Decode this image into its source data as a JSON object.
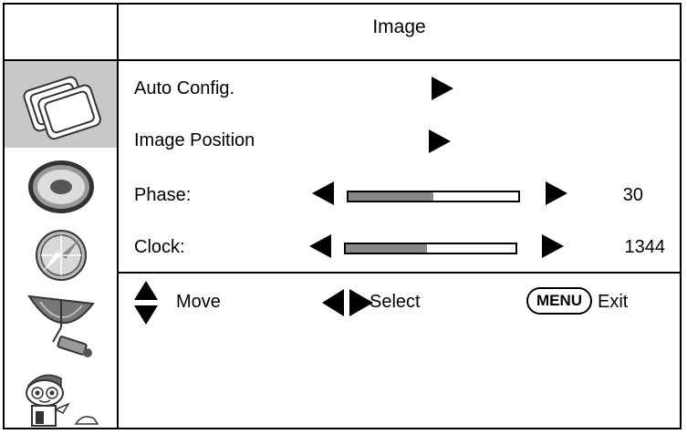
{
  "header": {
    "title": "Image"
  },
  "sidebar": {
    "items": [
      {
        "icon": "image-icon",
        "selected": true
      },
      {
        "icon": "disc-icon",
        "selected": false
      },
      {
        "icon": "compass-icon",
        "selected": false
      },
      {
        "icon": "satellite-dish-icon",
        "selected": false
      },
      {
        "icon": "mascot-icon",
        "selected": false
      }
    ]
  },
  "menu": {
    "auto_config": {
      "label": "Auto Config."
    },
    "image_position": {
      "label": "Image Position"
    },
    "phase": {
      "label": "Phase:",
      "value": "30",
      "level": 0.5
    },
    "clock": {
      "label": "Clock:",
      "value": "1344",
      "level": 0.48
    }
  },
  "footer": {
    "move_label": "Move",
    "select_label": "Select",
    "menu_key": "MENU",
    "exit_label": "Exit"
  },
  "colors": {
    "selected_bg": "#c8c8c8",
    "slider_fill": "#888888"
  }
}
